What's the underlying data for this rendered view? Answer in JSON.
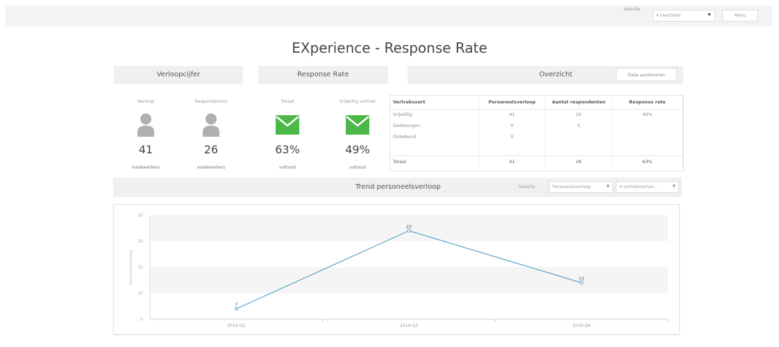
{
  "topbar": {
    "selectie_label": "Selectie",
    "period_select": "4 kwartalen",
    "menu_label": "Menu"
  },
  "page_title": "EXperience - Response Rate",
  "sections": {
    "verloopcijfer": "Verloopcijfer",
    "response_rate": "Response Rate",
    "overzicht": "Overzicht",
    "data_button": "Data aanleveren"
  },
  "kpis": [
    {
      "label": "Verloop",
      "value": "41",
      "sub": "medewerkers",
      "icon": "person-icon"
    },
    {
      "label": "Respondenten",
      "value": "26",
      "sub": "medewerkers",
      "icon": "person-icon"
    },
    {
      "label": "Totaal",
      "value": "63%",
      "sub": "voltooid",
      "icon": "envelope-icon"
    },
    {
      "label": "Vrijwillig vertrek",
      "value": "49%",
      "sub": "voltooid",
      "icon": "envelope-icon"
    }
  ],
  "overview_table": {
    "headers": [
      "Vertreksoort",
      "Personeelsverloop",
      "Aantal respondenten",
      "Response rate"
    ],
    "rows": [
      [
        "Vrijwillig",
        "41",
        "20",
        "49%"
      ],
      [
        "Gedwongen",
        "0",
        "5",
        ""
      ],
      [
        "Onbekend",
        "0",
        "",
        ""
      ]
    ],
    "total": [
      "Totaal",
      "41",
      "26",
      "63%"
    ]
  },
  "trend": {
    "title": "Trend personeelsverloop",
    "selectie_label": "Selectie",
    "dropdown_measure": "Personeelsverloop",
    "dropdown_types": "4 vertreksoorten..."
  },
  "colors": {
    "icon_gray": "#b0b0b0",
    "envelope_green": "#4cb84a",
    "line": "#5b9fc4",
    "band": "#f5f5f5"
  },
  "chart_data": {
    "type": "line",
    "categories": [
      "2019-Q2",
      "2019-Q3",
      "2019-Q4"
    ],
    "series": [
      {
        "values": [
          7,
          22,
          12
        ]
      }
    ],
    "ylabel": "Personeelsverloop",
    "ylim": [
      5,
      25
    ],
    "yticks": [
      5,
      10,
      15,
      20,
      25
    ],
    "data_labels": [
      "7",
      "22",
      "12"
    ],
    "grid": "alternating bands",
    "legend": "none"
  }
}
